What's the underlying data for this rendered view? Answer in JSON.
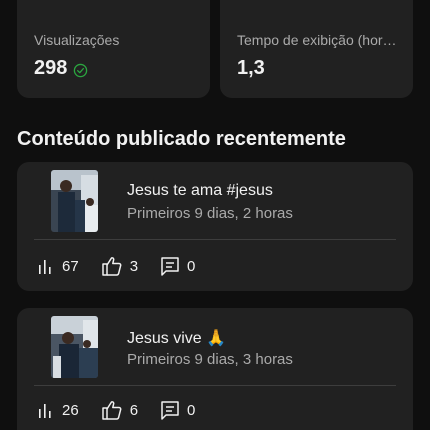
{
  "stats": [
    {
      "label": "Visualizações",
      "value": "298"
    },
    {
      "label": "Tempo de exibição (hor…",
      "value": "1,3"
    }
  ],
  "section_title": "Conteúdo publicado recentemente",
  "videos": [
    {
      "title": "Jesus te ama #jesus",
      "subtitle": "Primeiros 9 dias, 2 horas",
      "views": "67",
      "likes": "3",
      "comments": "0"
    },
    {
      "title": "Jesus vive 🙏",
      "subtitle": "Primeiros 9 dias, 3 horas",
      "views": "26",
      "likes": "6",
      "comments": "0"
    }
  ],
  "colors": {
    "background": "#0f0f0f",
    "card": "#212121",
    "primary_text": "#f1f1f1",
    "secondary_text": "#aaaaaa",
    "check_green": "#2ba640"
  },
  "icons": [
    "check-circle-icon",
    "bar-chart-icon",
    "thumbs-up-icon",
    "comment-icon"
  ]
}
